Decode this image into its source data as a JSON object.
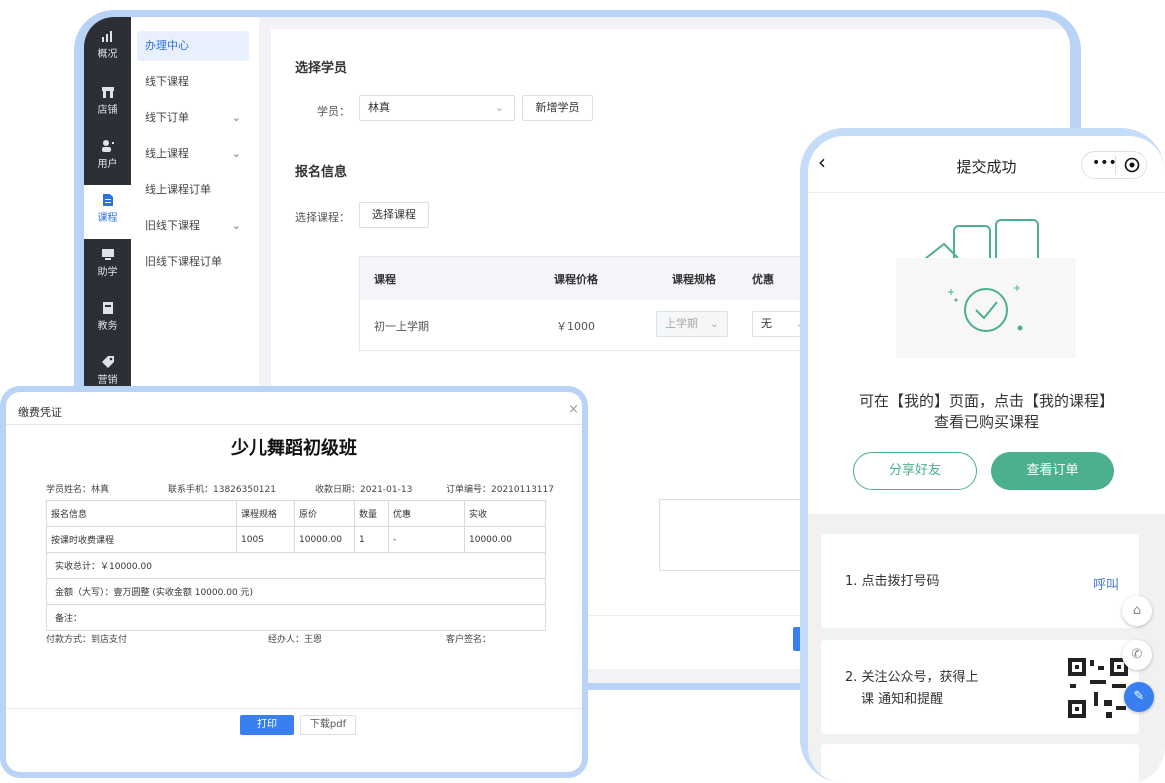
{
  "admin": {
    "rail": [
      {
        "label": "概况",
        "icon": "chart-icon"
      },
      {
        "label": "店铺",
        "icon": "store-icon"
      },
      {
        "label": "用户",
        "icon": "user-icon"
      },
      {
        "label": "课程",
        "icon": "document-icon",
        "active": true
      },
      {
        "label": "助学",
        "icon": "monitor-icon"
      },
      {
        "label": "教务",
        "icon": "book-icon"
      },
      {
        "label": "营销",
        "icon": "tag-icon"
      }
    ],
    "submenu": [
      {
        "label": "办理中心",
        "active": true
      },
      {
        "label": "线下课程"
      },
      {
        "label": "线下订单",
        "has_arrow": true
      },
      {
        "label": "线上课程",
        "has_arrow": true
      },
      {
        "label": "线上课程订单"
      },
      {
        "label": "旧线下课程",
        "has_arrow": true
      },
      {
        "label": "旧线下课程订单"
      }
    ],
    "select_student": {
      "heading": "选择学员",
      "label": "学员：",
      "value": "林真",
      "add_button": "新增学员"
    },
    "enroll": {
      "heading": "报名信息",
      "label": "选择课程：",
      "select_button": "选择课程"
    },
    "course_table": {
      "headers": [
        "课程",
        "课程价格",
        "课程规格",
        "优惠"
      ],
      "row": {
        "course": "初一上学期",
        "price": "￥1000",
        "spec": "上学期",
        "discount": "无"
      }
    }
  },
  "receipt": {
    "title": "缴费凭证",
    "school_name": "少儿舞蹈初级班",
    "meta": {
      "student": "学员姓名：林真",
      "phone": "联系手机：13826350121",
      "date": "收款日期：2021-01-13",
      "order_no": "订单编号：20210113117"
    },
    "headers": [
      "报名信息",
      "课程规格",
      "原价",
      "数量",
      "优惠",
      "实收"
    ],
    "row": [
      "按课时收费课程",
      "100S",
      "10000.00",
      "1",
      "-",
      "10000.00"
    ],
    "total": "实收总计：￥10000.00",
    "amount_words": "金额（大写）：壹万圆整 (实收金额 10000.00 元)",
    "remark": "备注：",
    "footer": {
      "payment": "付款方式：到店支付",
      "handler": "经办人：王恩",
      "signature": "客户签名："
    },
    "print_button": "打印",
    "pdf_button": "下载pdf"
  },
  "phone": {
    "title": "提交成功",
    "message_line1": "可在【我的】页面，点击【我的课程】",
    "message_line2": "查看已购买课程",
    "share_button": "分享好友",
    "order_button": "查看订单",
    "step1": "1. 点击拨打号码",
    "call_link": "呼叫",
    "step2_line1": "2. 关注公众号，获得上",
    "step2_line2": "课 通知和提醒",
    "accent": "#4caf8f"
  }
}
